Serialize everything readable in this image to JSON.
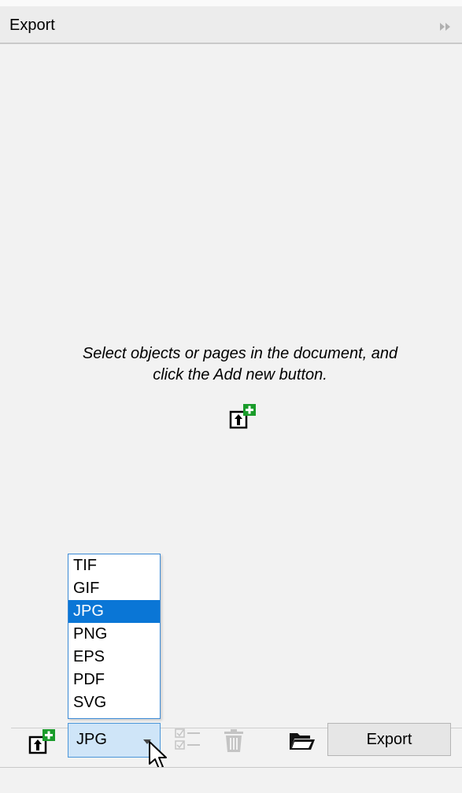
{
  "panel": {
    "title": "Export"
  },
  "empty_state": {
    "line1": "Select objects or pages in the document, and",
    "line2": "click the Add new button."
  },
  "format": {
    "selected": "JPG",
    "options": [
      "TIF",
      "GIF",
      "JPG",
      "PNG",
      "EPS",
      "PDF",
      "SVG"
    ]
  },
  "toolbar": {
    "export_label": "Export"
  },
  "icons": {
    "add": "add-export-item-icon",
    "collapse": "collapse-panel-icon",
    "checklist": "checklist-icon",
    "trash": "trash-icon",
    "folder": "folder-icon"
  },
  "colors": {
    "selection": "#0a76d6",
    "plus": "#1a9c2b",
    "select_bg": "#cfe5f8"
  }
}
